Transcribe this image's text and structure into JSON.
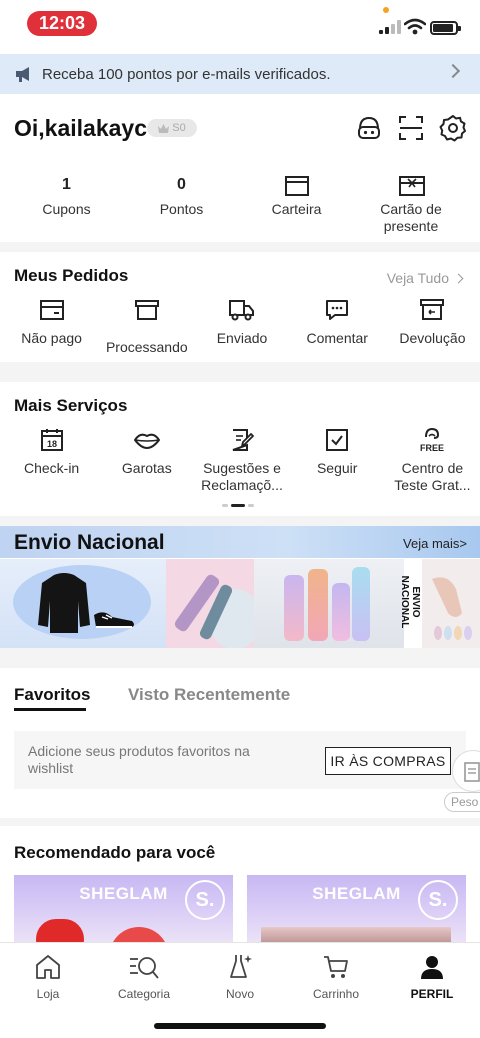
{
  "status_bar": {
    "time": "12:03"
  },
  "promo_banner": {
    "text": "Receba 100 pontos por e-mails verificados.",
    "icon": "megaphone-icon"
  },
  "profile": {
    "greeting": "Oi,kailakayc",
    "level_badge": "S0",
    "icons": [
      "support-icon",
      "scan-icon",
      "settings-icon"
    ],
    "stats": [
      {
        "value": "1",
        "label": "Cupons"
      },
      {
        "value": "0",
        "label": "Pontos"
      },
      {
        "icon": "wallet-icon",
        "label": "Carteira"
      },
      {
        "icon": "gift-card-icon",
        "label": "Cartão de presente"
      }
    ]
  },
  "orders": {
    "title": "Meus Pedidos",
    "see_all": "Veja Tudo",
    "items": [
      {
        "label": "Não pago",
        "icon": "wallet-icon"
      },
      {
        "label": "Processando",
        "icon": "box-icon"
      },
      {
        "label": "Enviado",
        "icon": "truck-icon"
      },
      {
        "label": "Comentar",
        "icon": "comment-icon"
      },
      {
        "label": "Devolução",
        "icon": "return-box-icon"
      }
    ]
  },
  "services": {
    "title": "Mais Serviços",
    "items": [
      {
        "label": "Check-in",
        "icon": "calendar-icon",
        "day": "18"
      },
      {
        "label": "Garotas",
        "icon": "lips-icon"
      },
      {
        "label": "Sugestões e Reclamaçõ...",
        "icon": "feedback-icon"
      },
      {
        "label": "Seguir",
        "icon": "follow-icon"
      },
      {
        "label": "Centro de Teste Grat...",
        "icon": "free-trial-icon",
        "badge": "FREE"
      }
    ]
  },
  "nacional": {
    "title": "Envio Nacional",
    "more": "Veja mais>",
    "side_text": "ENVIO NACIONAL"
  },
  "favorites": {
    "tabs": [
      "Favoritos",
      "Visto Recentemente"
    ],
    "active_tab": "Favoritos",
    "message": "Adicione seus produtos favoritos na wishlist",
    "button": "IR ÀS COMPRAS",
    "float_label": "Peso"
  },
  "recommended": {
    "title": "Recomendado para você",
    "cards": [
      {
        "brand": "SHEGLAM",
        "seal": "S."
      },
      {
        "brand": "SHEGLAM",
        "seal": "S."
      }
    ]
  },
  "tabbar": {
    "items": [
      {
        "label": "Loja",
        "icon": "home-icon"
      },
      {
        "label": "Categoria",
        "icon": "category-icon"
      },
      {
        "label": "Novo",
        "icon": "dress-icon"
      },
      {
        "label": "Carrinho",
        "icon": "cart-icon"
      },
      {
        "label": "PERFIL",
        "icon": "profile-icon"
      }
    ],
    "active": "PERFIL"
  },
  "colors": {
    "accent": "#e0303a",
    "banner_bg": "#dfeaf8",
    "sheglam_purple": "#c7b8f2"
  }
}
